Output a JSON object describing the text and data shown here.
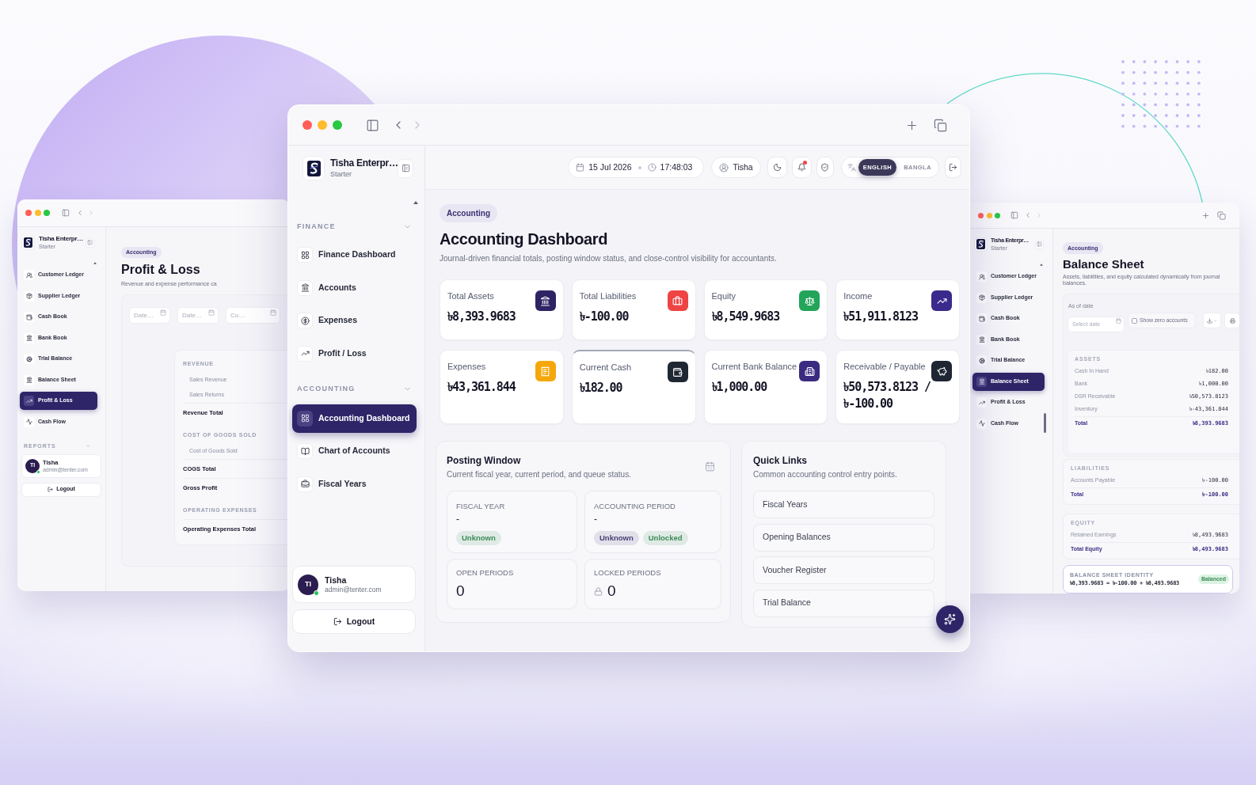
{
  "left_window": {
    "brand": {
      "name": "Tisha Enterpr…",
      "plan": "Starter"
    },
    "nav_items": [
      {
        "label": "Customer Ledger",
        "selected": false
      },
      {
        "label": "Supplier Ledger",
        "selected": false
      },
      {
        "label": "Cash Book",
        "selected": false
      },
      {
        "label": "Bank Book",
        "selected": false
      },
      {
        "label": "Trial Balance",
        "selected": false
      },
      {
        "label": "Balance Sheet",
        "selected": false
      },
      {
        "label": "Profit & Loss",
        "selected": true
      },
      {
        "label": "Cash Flow",
        "selected": false
      }
    ],
    "reports_section": "REPORTS",
    "user": {
      "initials": "TI",
      "name": "Tisha",
      "email": "admin@tenter.com",
      "online": true
    },
    "logout": "Logout",
    "page": {
      "badge": "Accounting",
      "title": "Profit & Loss",
      "subtitle": "Revenue and expense performance ca"
    },
    "filters": [
      {
        "placeholder": "Date…"
      },
      {
        "placeholder": "Date…"
      },
      {
        "placeholder": "Co…"
      }
    ],
    "report_rows": [
      {
        "kind": "section",
        "label": "REVENUE"
      },
      {
        "kind": "line",
        "label": "Sales Revenue"
      },
      {
        "kind": "line",
        "label": "Sales Returns"
      },
      {
        "kind": "total",
        "label": "Revenue Total"
      },
      {
        "kind": "section",
        "label": "COST OF GOODS SOLD"
      },
      {
        "kind": "line",
        "label": "Cost of Goods Sold"
      },
      {
        "kind": "total",
        "label": "COGS Total"
      },
      {
        "kind": "total",
        "label": "Gross Profit"
      },
      {
        "kind": "section",
        "label": "OPERATING EXPENSES"
      },
      {
        "kind": "total",
        "label": "Operating Expenses Total"
      }
    ]
  },
  "main_window": {
    "brand": {
      "name": "Tisha Enterpr…",
      "plan": "Starter"
    },
    "nav_sections": [
      {
        "title": "FINANCE",
        "items": [
          {
            "label": "Finance Dashboard",
            "selected": false
          },
          {
            "label": "Accounts",
            "selected": false
          },
          {
            "label": "Expenses",
            "selected": false
          },
          {
            "label": "Profit / Loss",
            "selected": false
          }
        ]
      },
      {
        "title": "ACCOUNTING",
        "items": [
          {
            "label": "Accounting Dashboard",
            "selected": true
          },
          {
            "label": "Chart of Accounts",
            "selected": false
          },
          {
            "label": "Fiscal Years",
            "selected": false
          }
        ]
      }
    ],
    "user": {
      "initials": "TI",
      "name": "Tisha",
      "email": "admin@tenter.com",
      "online": true
    },
    "logout": "Logout",
    "header": {
      "date": "15 Jul 2026",
      "time": "17:48:03",
      "user": "Tisha",
      "unread_notifications": true,
      "languages": [
        {
          "label": "ENGLISH",
          "selected": true
        },
        {
          "label": "BANGLA",
          "selected": false
        }
      ]
    },
    "page": {
      "badge": "Accounting",
      "title": "Accounting Dashboard",
      "subtitle": "Journal-driven financial totals, posting window status, and close-control visibility for accountants."
    },
    "stats": [
      {
        "label": "Total Assets",
        "value": "৳8,393.9683",
        "color": "#2e2463",
        "hovered": false
      },
      {
        "label": "Total Liabilities",
        "value": "৳-100.00",
        "color": "#ef4444",
        "hovered": false
      },
      {
        "label": "Equity",
        "value": "৳8,549.9683",
        "color": "#22a559",
        "hovered": false
      },
      {
        "label": "Income",
        "value": "৳51,911.8123",
        "color": "#3b2a8c",
        "hovered": false
      },
      {
        "label": "Expenses",
        "value": "৳43,361.844",
        "color": "#f5a70a",
        "hovered": false
      },
      {
        "label": "Current Cash",
        "value": "৳182.00",
        "color": "#1f2733",
        "hovered": true
      },
      {
        "label": "Current Bank Balance",
        "value": "৳1,000.00",
        "color": "#3a2b80",
        "hovered": false
      },
      {
        "label": "Receivable / Payable",
        "value": "৳50,573.8123 / ৳-100.00",
        "color": "#1e2533",
        "hovered": false
      }
    ],
    "posting_window": {
      "title": "Posting Window",
      "subtitle": "Current fiscal year, current period, and queue status.",
      "tiles": [
        {
          "kind": "status",
          "label": "FISCAL YEAR",
          "value": "-",
          "tags": [
            {
              "label": "Unknown",
              "color": "#3d8b57"
            }
          ]
        },
        {
          "kind": "status",
          "label": "ACCOUNTING PERIOD",
          "value": "-",
          "tags": [
            {
              "label": "Unknown",
              "color": "#4a3f75"
            },
            {
              "label": "Unlocked",
              "color": "#3d8b57"
            }
          ]
        },
        {
          "kind": "count",
          "label": "OPEN PERIODS",
          "value": "0",
          "locked": false
        },
        {
          "kind": "count",
          "label": "LOCKED PERIODS",
          "value": "0",
          "locked": true
        }
      ]
    },
    "quick_links": {
      "title": "Quick Links",
      "subtitle": "Common accounting control entry points.",
      "links": [
        "Fiscal Years",
        "Opening Balances",
        "Voucher Register",
        "Trial Balance"
      ]
    }
  },
  "right_window": {
    "brand": {
      "name": "Tisha Enterpr…",
      "plan": "Starter"
    },
    "nav_items": [
      {
        "label": "Customer Ledger",
        "selected": false
      },
      {
        "label": "Supplier Ledger",
        "selected": false
      },
      {
        "label": "Cash Book",
        "selected": false
      },
      {
        "label": "Bank Book",
        "selected": false
      },
      {
        "label": "Trial Balance",
        "selected": false
      },
      {
        "label": "Balance Sheet",
        "selected": true
      },
      {
        "label": "Profit & Loss",
        "selected": false
      },
      {
        "label": "Cash Flow",
        "selected": false
      }
    ],
    "page": {
      "badge": "Accounting",
      "title": "Balance Sheet",
      "subtitle": "Assets, liabilities, and equity calculated dynamically from journal balances."
    },
    "date_filter": {
      "label": "As of date",
      "placeholder": "Select date"
    },
    "zero_accounts": {
      "label": "Show zero accounts",
      "checked": false
    },
    "sections": [
      {
        "title": "ASSETS",
        "rows": [
          {
            "label": "Cash In Hand",
            "value": "৳182.00"
          },
          {
            "label": "Bank",
            "value": "৳1,000.00"
          },
          {
            "label": "DSR Receivable",
            "value": "৳50,573.8123"
          },
          {
            "label": "Inventory",
            "value": "৳-43,361.844"
          }
        ],
        "total": {
          "label": "Total",
          "value": "৳8,393.9683"
        }
      },
      {
        "title": "LIABILITIES",
        "rows": [
          {
            "label": "Accounts Payable",
            "value": "৳-100.00"
          }
        ],
        "total": {
          "label": "Total",
          "value": "৳-100.00"
        }
      },
      {
        "title": "EQUITY",
        "rows": [
          {
            "label": "Retained Earnings",
            "value": "৳8,493.9683"
          }
        ],
        "total": {
          "label": "Total Equity",
          "value": "৳8,493.9683"
        }
      }
    ],
    "identity": {
      "title": "BALANCE SHEET IDENTITY",
      "equation": "৳8,393.9683 = ৳-100.00 + ৳8,493.9683",
      "status": "Balanced"
    }
  }
}
